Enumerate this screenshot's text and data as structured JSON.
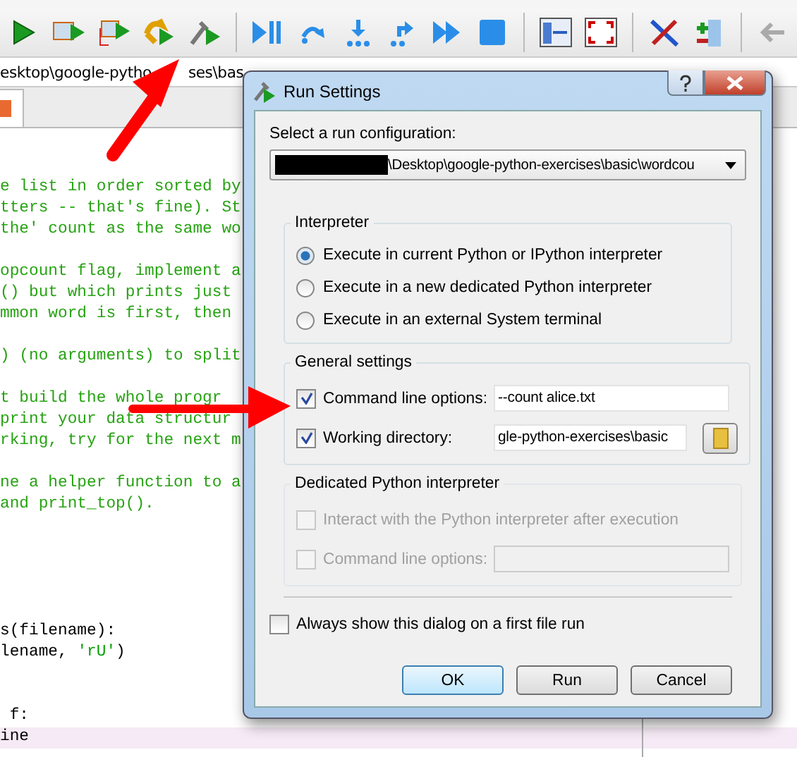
{
  "path_bar": {
    "segments": [
      "esktop\\google-pytho",
      "ses\\bas"
    ]
  },
  "editor": {
    "lines": [
      {
        "text": "e list in order sorted by",
        "kind": "comment",
        "current": false
      },
      {
        "text": "tters -- that's fine). St",
        "kind": "comment",
        "current": false
      },
      {
        "text": "the' count as the same wo",
        "kind": "comment",
        "current": false
      },
      {
        "kind": "blank",
        "current": false
      },
      {
        "text": "opcount flag, implement a",
        "kind": "comment",
        "current": false
      },
      {
        "text": "() but which prints just",
        "kind": "comment",
        "current": false
      },
      {
        "text": "mmon word is first, then",
        "kind": "comment",
        "current": false
      },
      {
        "kind": "blank",
        "current": false
      },
      {
        "text": ") (no arguments) to split",
        "kind": "comment",
        "current": false
      },
      {
        "kind": "blank",
        "current": false
      },
      {
        "text": "t build the whole progr",
        "kind": "comment",
        "current": false
      },
      {
        "text": "print your data structur",
        "kind": "comment",
        "current": false
      },
      {
        "text": "rking, try for the next m",
        "kind": "comment",
        "current": false
      },
      {
        "kind": "blank",
        "current": false
      },
      {
        "text": "ne a helper function to a",
        "kind": "comment",
        "current": false
      },
      {
        "text": "and print_top().",
        "kind": "comment",
        "current": false
      },
      {
        "kind": "blank",
        "current": false
      },
      {
        "kind": "blank",
        "current": false
      },
      {
        "kind": "blank",
        "current": false
      },
      {
        "kind": "blank",
        "current": false
      },
      {
        "kind": "blank",
        "current": false
      },
      {
        "text": "s(filename):",
        "kind": "code",
        "current": false
      },
      {
        "text": "lename, **'rU'**)",
        "kind": "code",
        "current": false
      },
      {
        "kind": "blank",
        "current": false
      },
      {
        "kind": "blank",
        "current": false
      },
      {
        "text": " f:",
        "kind": "code",
        "current": false
      },
      {
        "text": "ine",
        "kind": "code",
        "current": true
      }
    ]
  },
  "dialog": {
    "title": "Run Settings",
    "config_label": "Select a run configuration:",
    "config_value": "\\Desktop\\google-python-exercises\\basic\\wordcou",
    "interpreter": {
      "title": "Interpreter",
      "options": [
        {
          "label": "Execute in current Python or IPython interpreter",
          "selected": true
        },
        {
          "label": "Execute in a new dedicated Python interpreter",
          "selected": false
        },
        {
          "label": "Execute in an external System terminal",
          "selected": false
        }
      ]
    },
    "general": {
      "title": "General settings",
      "rows": [
        {
          "kind": "text",
          "label": "Command line options:",
          "checked": true,
          "value": "--count alice.txt"
        },
        {
          "kind": "directory",
          "label": "Working directory:",
          "checked": true,
          "value": "gle-python-exercises\\basic"
        }
      ]
    },
    "dedicated": {
      "title": "Dedicated Python interpreter",
      "disabled": true,
      "rows": [
        {
          "kind": "checkbox",
          "label": "Interact with the Python interpreter after execution",
          "checked": false
        },
        {
          "kind": "text",
          "label": "Command line options:",
          "checked": false
        }
      ]
    },
    "always_show": {
      "label": "Always show this dialog on a first file run",
      "checked": false
    },
    "buttons": [
      {
        "label": "OK",
        "default": true
      },
      {
        "label": "Run",
        "default": false
      },
      {
        "label": "Cancel",
        "default": false
      }
    ]
  }
}
